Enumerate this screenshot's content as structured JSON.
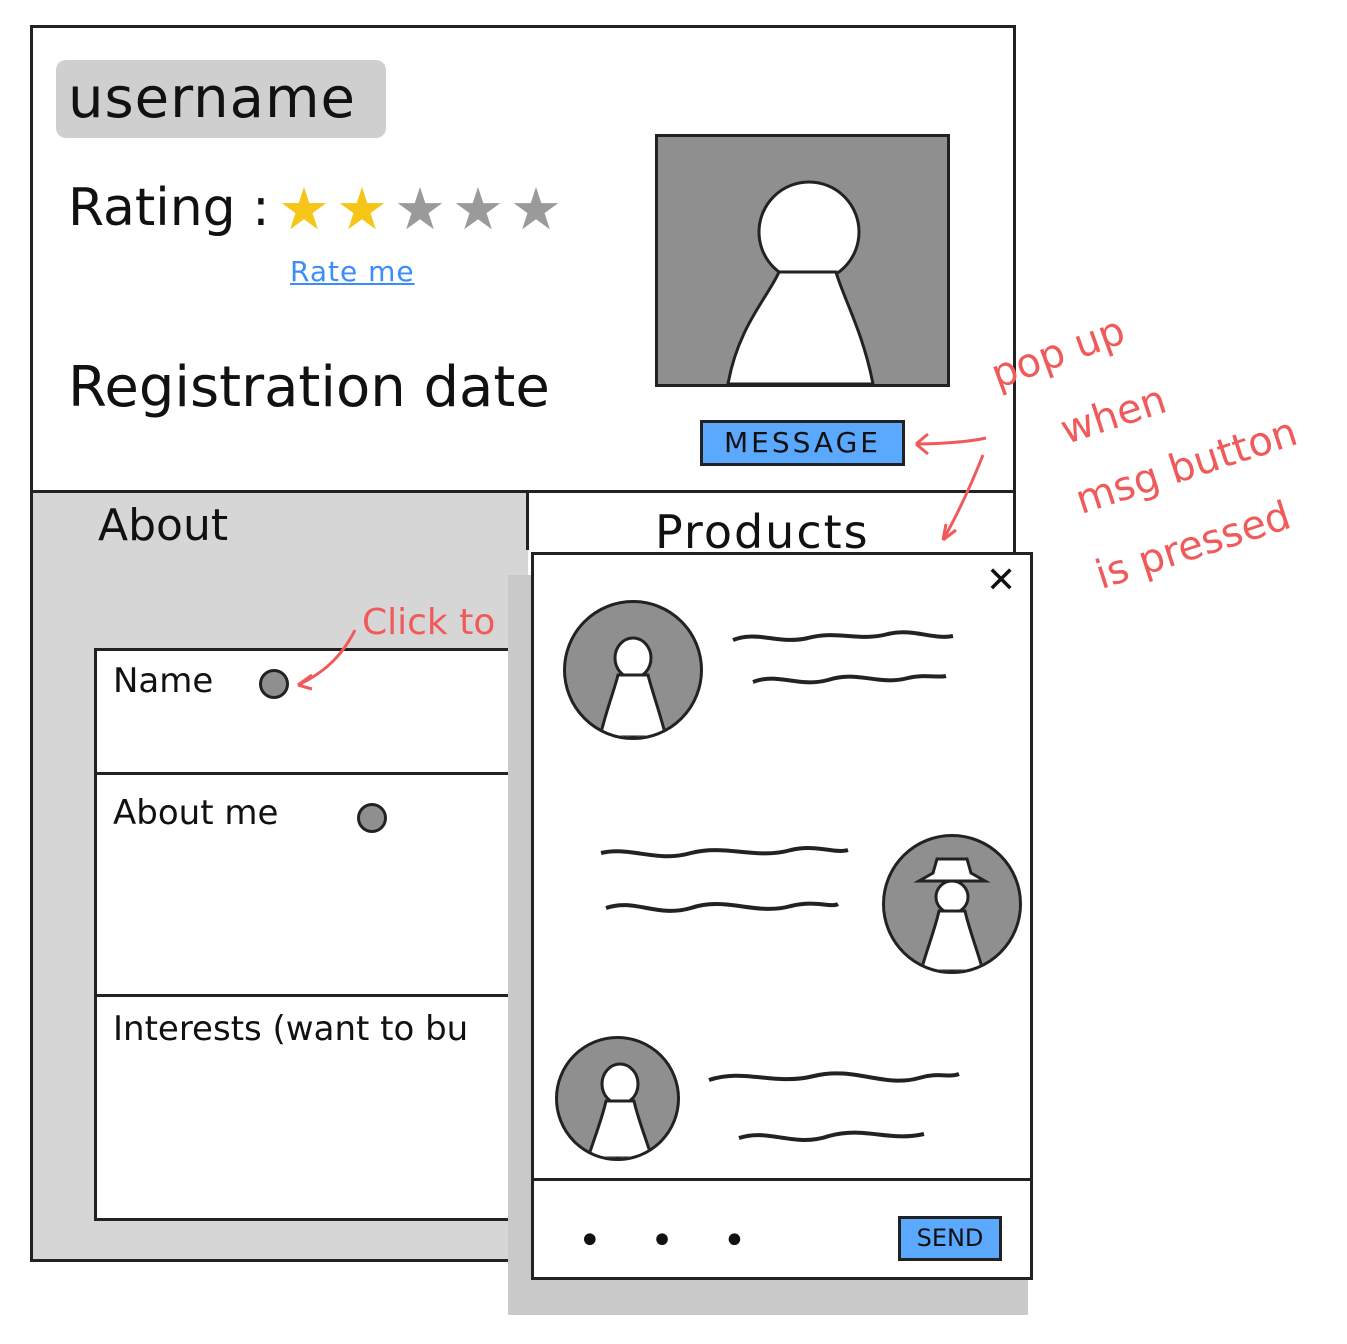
{
  "profile": {
    "username": "username",
    "rating_label": "Rating :",
    "rating_stars": 2,
    "rating_max": 5,
    "rate_me_link": "Rate me",
    "registration_label": "Registration date",
    "message_button": "MESSAGE"
  },
  "tabs": [
    {
      "label": "About"
    },
    {
      "label": "Products"
    }
  ],
  "about_form": {
    "fields": [
      {
        "label": "Name"
      },
      {
        "label": "About me"
      },
      {
        "label": "Interests (want to bu"
      }
    ]
  },
  "annotations": {
    "click_to": "Click to",
    "popup_note": [
      "pop up",
      "when",
      "msg button",
      "is pressed"
    ]
  },
  "chat_popup": {
    "close_glyph": "✕",
    "typing_indicator": "• • •",
    "send_button": "SEND"
  },
  "colors": {
    "accent_blue": "#5aa9ff",
    "link_blue": "#3c8dfa",
    "star_filled": "#f5c518",
    "star_empty": "#9a9a9a",
    "note_red": "#f05a5a",
    "avatar_gray": "#8f8f8f",
    "panel_gray": "#d6d6d6"
  },
  "icons": {
    "star": "star-icon",
    "edit": "edit-icon",
    "close": "close-icon",
    "user": "user-silhouette-icon",
    "cowboy": "cowboy-user-icon"
  }
}
